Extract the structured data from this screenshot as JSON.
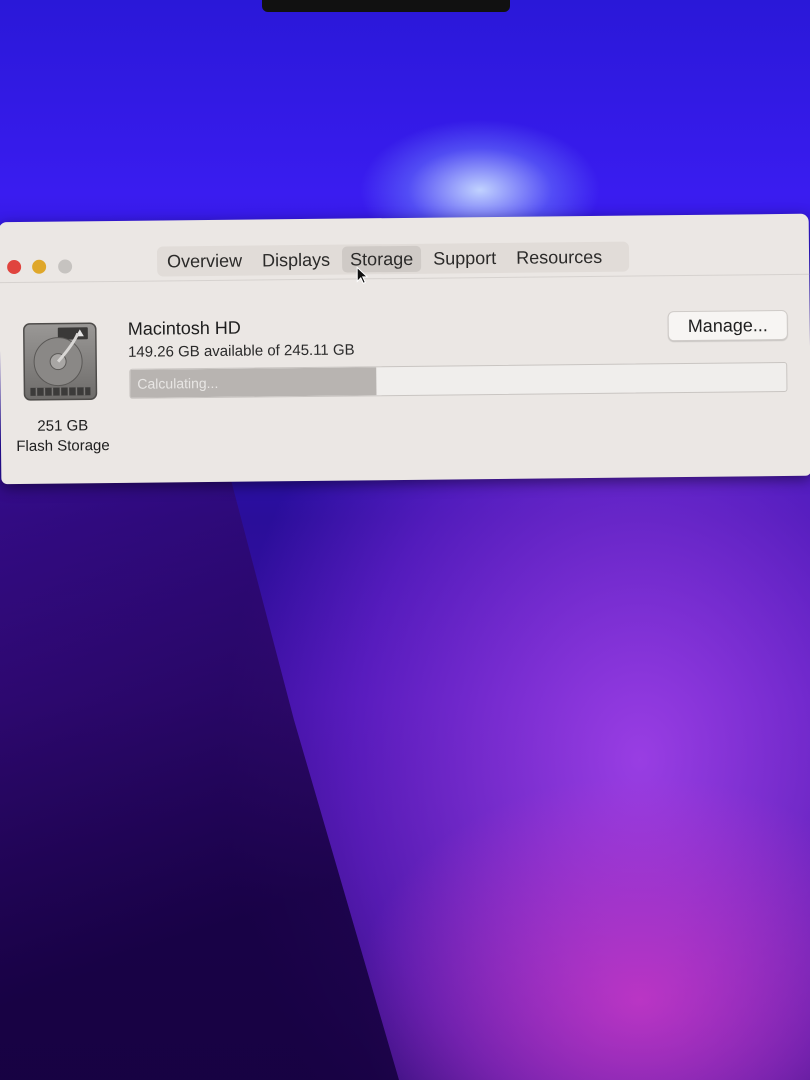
{
  "window": {
    "tabs": [
      {
        "label": "Overview",
        "active": false
      },
      {
        "label": "Displays",
        "active": false
      },
      {
        "label": "Storage",
        "active": true
      },
      {
        "label": "Support",
        "active": false
      },
      {
        "label": "Resources",
        "active": false
      }
    ]
  },
  "storage": {
    "drive_size": "251 GB",
    "drive_type": "Flash Storage",
    "volume_name": "Macintosh HD",
    "availability": "149.26 GB available of 245.11 GB",
    "manage_label": "Manage...",
    "bar_status": "Calculating...",
    "bar_progress_fraction": 0.375
  },
  "colors": {
    "close": "#e0443e",
    "minimize": "#dfa72a",
    "zoom_inactive": "#c6c3c0"
  },
  "icons": [
    "hard-drive-icon",
    "mouse-pointer-icon"
  ]
}
